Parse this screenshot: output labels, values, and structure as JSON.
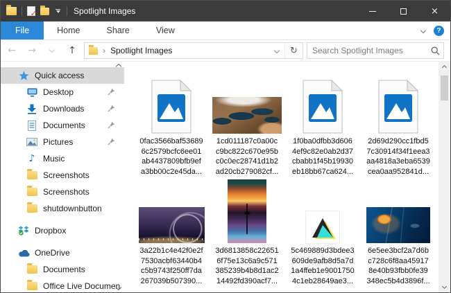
{
  "colors": {
    "accent": "#2b87d8",
    "titlebar_bg": "#3b3b3b",
    "selection": "#d9d9d9",
    "folder_yellow": "#f3c75a",
    "icon_blue": "#1173c5"
  },
  "window": {
    "title": "Spotlight Images"
  },
  "ribbon": {
    "tabs": [
      "File",
      "Home",
      "Share",
      "View"
    ],
    "active_tab": "File"
  },
  "address": {
    "path": "Spotlight Images",
    "search_placeholder": "Search Spotlight Images"
  },
  "icons": {
    "back": "←",
    "forward": "→",
    "up": "↑",
    "refresh": "↻",
    "breadcrumb_arrow": "›",
    "close": "×",
    "music_note": "♪",
    "help": "?"
  },
  "sidebar": {
    "items": [
      {
        "label": "Quick access",
        "icon": "star",
        "level": 0,
        "selected": true
      },
      {
        "label": "Desktop",
        "icon": "monitor",
        "level": 1,
        "pinned": true
      },
      {
        "label": "Downloads",
        "icon": "download-arrow",
        "level": 1,
        "pinned": true
      },
      {
        "label": "Documents",
        "icon": "document",
        "level": 1,
        "pinned": true
      },
      {
        "label": "Pictures",
        "icon": "picture",
        "level": 1,
        "pinned": true
      },
      {
        "label": "Music",
        "icon": "music-note",
        "level": 1
      },
      {
        "label": "Screenshots",
        "icon": "folder",
        "level": 1
      },
      {
        "label": "Screenshots",
        "icon": "folder",
        "level": 1
      },
      {
        "label": "shutdownbutton",
        "icon": "folder",
        "level": 1
      },
      {
        "label": "Dropbox",
        "icon": "dropbox",
        "level": 0
      },
      {
        "label": "OneDrive",
        "icon": "onedrive-cloud",
        "level": 0
      },
      {
        "label": "Documents",
        "icon": "folder",
        "level": 1
      },
      {
        "label": "Office Live Documen",
        "icon": "folder",
        "level": 1
      }
    ]
  },
  "files": [
    {
      "name": "0fac3566baf53689\n6c2579bcfc6ee01\nab4437809bfb9ef\na3bb00c2e45da...",
      "thumb": "image-file-icon"
    },
    {
      "name": "1cd011187c0a00c\nc9bc822c670e95b\nc0c0ec28741d1b2\nad20cb279082cf...",
      "thumb": "canyon-aerial-photo"
    },
    {
      "name": "1f0ba0dfbb3d606\n4ef9c82e0ab2d37\ncbabb1f45b19930\neb18bb67ca624...",
      "thumb": "image-file-icon"
    },
    {
      "name": "2d69d290cc1fbd5\n7c30914f34f1eea3\naa4818a3eba6539\ncea0aa952841d...",
      "thumb": "image-file-icon"
    },
    {
      "name": "3a22b1c4e42f0e2f\n7530acbf63440b4\nc5b9743f250ff7da\n267039b507390...",
      "thumb": "night-lights-photo"
    },
    {
      "name": "3d6813858c22651\n6f75e13c6a9c571\n385239b4b8d1ac2\n14492fd390acf7...",
      "thumb": "sunset-needle-photo"
    },
    {
      "name": "5c469889d3bdee3\n609de9afb8d5a7d\n1a4ffeb1e9001750\n4c1eb28649ae3...",
      "thumb": "triangle-logo"
    },
    {
      "name": "6e5ee3bcf2a7d6b\nc728c6f8aa45917\n8e40b93fbb0fe39\n348ec5b4d3896f...",
      "thumb": "jellyfish-photo"
    }
  ]
}
